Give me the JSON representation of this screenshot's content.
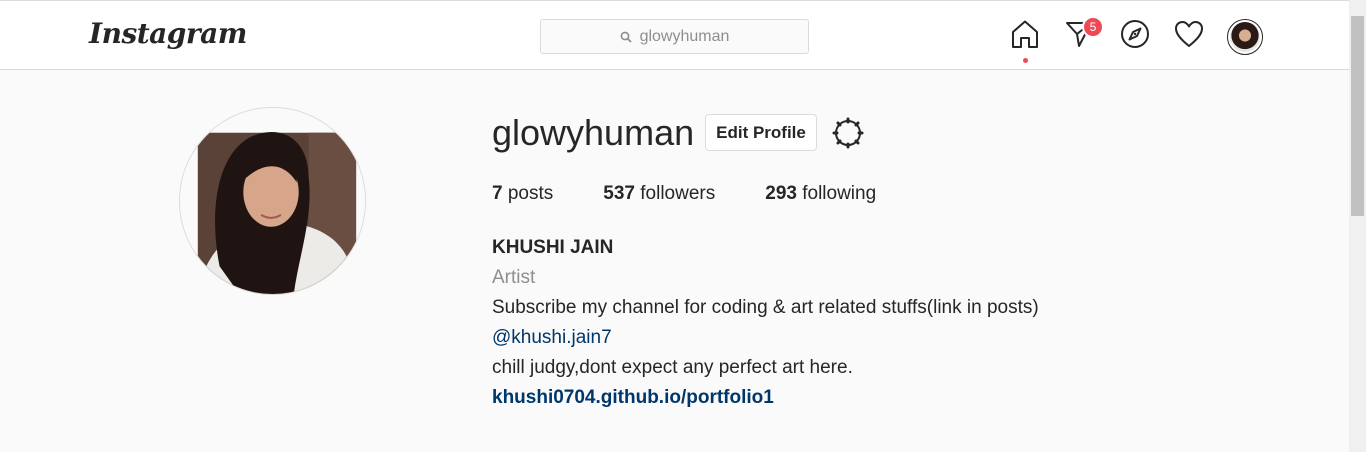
{
  "header": {
    "logo": "Instagram",
    "search_value": "glowyhuman",
    "notification_count": "5"
  },
  "nav_icons": [
    "home-icon",
    "direct-icon",
    "explore-icon",
    "heart-icon",
    "avatar"
  ],
  "colors": {
    "badge": "#ed4956",
    "link": "#00376b",
    "muted": "#8e8e8e",
    "background": "#fafafa"
  },
  "profile": {
    "username": "glowyhuman",
    "edit_button": "Edit Profile",
    "stats": {
      "posts_count": "7",
      "posts_label": "posts",
      "followers_count": "537",
      "followers_label": "followers",
      "following_count": "293",
      "following_label": "following"
    },
    "bio": {
      "full_name": "KHUSHI JAIN",
      "category": "Artist",
      "line1": "Subscribe my channel for coding & art related stuffs(link in posts)",
      "mention": "@khushi.jain7",
      "line2": "chill judgy,dont expect any perfect art here.",
      "website": "khushi0704.github.io/portfolio1"
    }
  }
}
